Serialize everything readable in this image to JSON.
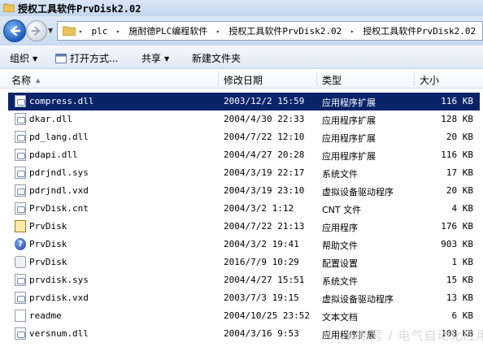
{
  "window": {
    "title": "授权工具软件PrvDisk2.02"
  },
  "address_bar": {
    "segments": [
      "plc",
      "施耐德PLC编程软件",
      "授权工具软件PrvDisk2.02",
      "授权工具软件PrvDisk2.02"
    ]
  },
  "toolbar": {
    "organize_label": "组织",
    "open_with_label": "打开方式...",
    "share_label": "共享",
    "new_folder_label": "新建文件夹"
  },
  "columns": {
    "name": "名称",
    "modified": "修改日期",
    "type": "类型",
    "size": "大小"
  },
  "files": [
    {
      "name": "compress.dll",
      "modified": "2003/12/2 15:59",
      "type": "应用程序扩展",
      "size": "116 KB",
      "icon": "dll-icon",
      "selected": true
    },
    {
      "name": "dkar.dll",
      "modified": "2004/4/30 22:33",
      "type": "应用程序扩展",
      "size": "128 KB",
      "icon": "dll-icon"
    },
    {
      "name": "pd_lang.dll",
      "modified": "2004/7/22 12:10",
      "type": "应用程序扩展",
      "size": "20 KB",
      "icon": "dll-icon"
    },
    {
      "name": "pdapi.dll",
      "modified": "2004/4/27 20:28",
      "type": "应用程序扩展",
      "size": "116 KB",
      "icon": "dll-icon"
    },
    {
      "name": "pdrjndl.sys",
      "modified": "2004/3/19 22:17",
      "type": "系统文件",
      "size": "17 KB",
      "icon": "sys-icon"
    },
    {
      "name": "pdrjndl.vxd",
      "modified": "2004/3/19 23:10",
      "type": "虚拟设备驱动程序",
      "size": "20 KB",
      "icon": "vxd-icon"
    },
    {
      "name": "PrvDisk.cnt",
      "modified": "2004/3/2 1:12",
      "type": "CNT 文件",
      "size": "4 KB",
      "icon": "file-icon"
    },
    {
      "name": "PrvDisk",
      "modified": "2004/7/22 21:13",
      "type": "应用程序",
      "size": "176 KB",
      "icon": "app-icon"
    },
    {
      "name": "PrvDisk",
      "modified": "2004/3/2 19:41",
      "type": "帮助文件",
      "size": "903 KB",
      "icon": "help-icon"
    },
    {
      "name": "PrvDisk",
      "modified": "2016/7/9 10:29",
      "type": "配置设置",
      "size": "1 KB",
      "icon": "settings-icon"
    },
    {
      "name": "prvdisk.sys",
      "modified": "2004/4/27 15:51",
      "type": "系统文件",
      "size": "15 KB",
      "icon": "sys-icon"
    },
    {
      "name": "prvdisk.vxd",
      "modified": "2003/7/3 19:15",
      "type": "虚拟设备驱动程序",
      "size": "13 KB",
      "icon": "vxd-icon"
    },
    {
      "name": "readme",
      "modified": "2004/10/25 23:52",
      "type": "文本文档",
      "size": "6 KB",
      "icon": "text-file-icon"
    },
    {
      "name": "versnum.dll",
      "modified": "2004/3/16 9:53",
      "type": "应用程序扩展",
      "size": "108 KB",
      "icon": "dll-icon"
    }
  ],
  "watermark": "头条号 / 电气自动化应用",
  "colors": {
    "selection": "#0a246a",
    "titlebar": "#c3d6ee"
  }
}
